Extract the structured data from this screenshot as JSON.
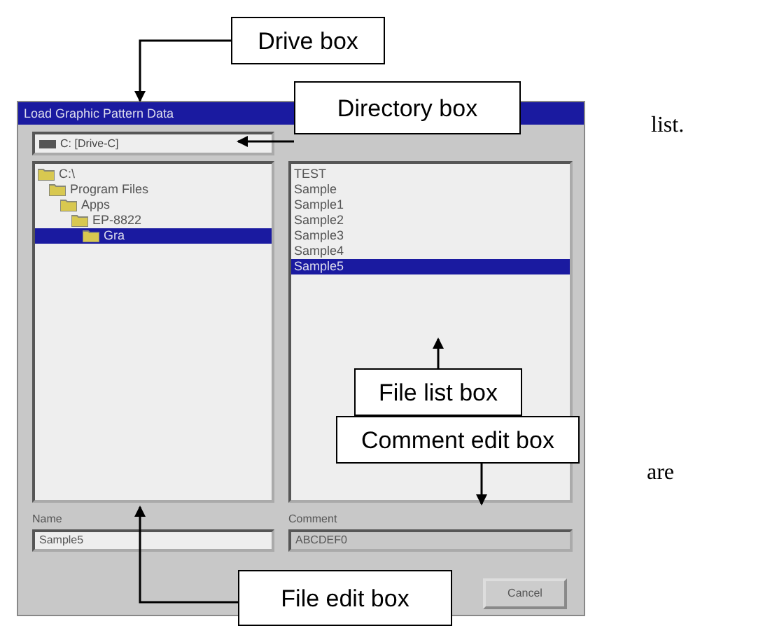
{
  "dialog": {
    "title": "Load Graphic Pattern Data",
    "drive": "C: [Drive-C]",
    "folders": [
      {
        "label": "C:\\",
        "selected": false,
        "children": [
          {
            "label": "Program Files",
            "selected": false,
            "children": [
              {
                "label": "Apps",
                "selected": false,
                "children": [
                  {
                    "label": "EP-8822",
                    "selected": false,
                    "children": [
                      {
                        "label": "Gra",
                        "selected": true
                      }
                    ]
                  }
                ]
              }
            ]
          }
        ]
      }
    ],
    "files": [
      {
        "label": "TEST",
        "selected": false
      },
      {
        "label": "Sample",
        "selected": false
      },
      {
        "label": "Sample1",
        "selected": false
      },
      {
        "label": "Sample2",
        "selected": false
      },
      {
        "label": "Sample3",
        "selected": false
      },
      {
        "label": "Sample4",
        "selected": false
      },
      {
        "label": "Sample5",
        "selected": true
      }
    ],
    "name_label": "Name",
    "name_value": "Sample5",
    "comment_label": "Comment",
    "comment_value": "ABCDEF0",
    "cancel": "Cancel"
  },
  "callouts": [
    {
      "label": "Drive box"
    },
    {
      "label": "Directory box"
    },
    {
      "label": "File list box"
    },
    {
      "label": "Comment edit box"
    },
    {
      "label": "File edit box"
    }
  ],
  "body_text": [
    {
      "text": "list."
    },
    {
      "text": "are"
    }
  ]
}
